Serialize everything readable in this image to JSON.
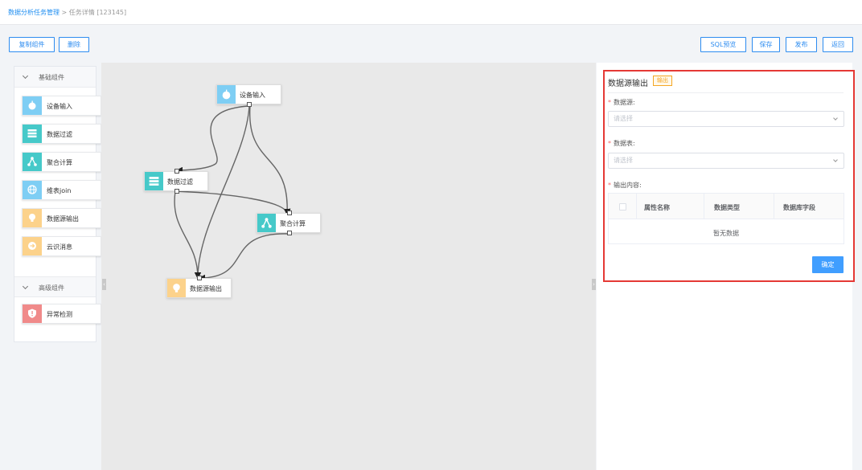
{
  "breadcrumb": {
    "root": "数据分析任务管理",
    "separator": " > ",
    "current": "任务详情 [123145]"
  },
  "toolbar_left": {
    "copy_label": "复制组件",
    "delete_label": "删除"
  },
  "toolbar_right": {
    "sql_preview_label": "SQL预览",
    "save_label": "保存",
    "publish_label": "发布",
    "back_label": "返回"
  },
  "sidebar": {
    "basic_group": "基础组件",
    "basic_items": [
      {
        "label": "设备输入",
        "icon": "apple-icon",
        "color": "#7ecef4"
      },
      {
        "label": "数据过滤",
        "icon": "table-icon",
        "color": "#46c9c9"
      },
      {
        "label": "聚合计算",
        "icon": "share-nodes-icon",
        "color": "#46c9c9"
      },
      {
        "label": "维表join",
        "icon": "globe-icon",
        "color": "#7ecef4"
      },
      {
        "label": "数据源输出",
        "icon": "bulb-icon",
        "color": "#fcd28b"
      },
      {
        "label": "云识消息",
        "icon": "arrow-circle-icon",
        "color": "#fcd28b"
      }
    ],
    "advanced_group": "高级组件",
    "advanced_items": [
      {
        "label": "异常检测",
        "icon": "shield-icon",
        "color": "#f08a8a"
      }
    ]
  },
  "canvas": {
    "nodes": [
      {
        "label": "设备输入"
      },
      {
        "label": "数据过滤"
      },
      {
        "label": "聚合计算"
      },
      {
        "label": "数据源输出"
      }
    ]
  },
  "form": {
    "title": "数据源输出",
    "tag": "输出",
    "datasource_label": "数据源:",
    "datasource_placeholder": "请选择",
    "datatable_label": "数据表:",
    "datatable_placeholder": "请选择",
    "output_label": "输出内容:",
    "table_headers": [
      "属性名称",
      "数据类型",
      "数据库字段"
    ],
    "empty_text": "暂无数据",
    "confirm_label": "确定",
    "required_mark": "*"
  }
}
